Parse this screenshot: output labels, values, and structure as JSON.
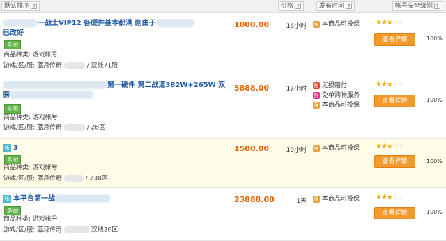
{
  "header": {
    "sort_default": "默认排序",
    "price": "价格",
    "publish_time": "发布时间",
    "security_level": "帐号安全级别"
  },
  "labels": {
    "category": "商品种类:",
    "server": "游戏/区/服:",
    "view_button": "查看详情",
    "tag_text": "多图",
    "icon_tag": "帐"
  },
  "listings": [
    {
      "title_line1": "一战士VIP12 各硬件基本都满 刚由于",
      "title_line2": "已改好",
      "category_value": "游戏帐号",
      "game": "蓝月传奇",
      "server": "/ 双线71服",
      "price": "1000.00",
      "time": "16小时",
      "guarantees": [
        "本商品可投保"
      ],
      "stars": 3,
      "percent": "100%"
    },
    {
      "title_line1": "第一硬件 第二战道382W+265W 双16翅",
      "title_line2": "膀",
      "category_value": "游戏帐号",
      "game": "蓝月传奇",
      "server": "/ 28区",
      "price": "5888.00",
      "time": "17小时",
      "guarantees": [
        "无损赔付",
        "免单购物服务",
        "本商品可投保"
      ],
      "stars": 3,
      "percent": "100%"
    },
    {
      "title_line1": "3",
      "category_value": "游戏帐号",
      "game": "蓝月传奇",
      "server": "/ 238区",
      "price": "1500.00",
      "time": "19小时",
      "guarantees": [
        "本商品可投保"
      ],
      "stars": 3,
      "percent": "100%"
    },
    {
      "title_line1": "本平台第一战",
      "category_value": "游戏帐号",
      "game": "蓝月传奇",
      "server": "双线20区",
      "price": "23888.00",
      "time": "1天",
      "guarantees": [
        "本商品可投保"
      ],
      "stars": 3,
      "percent": "100%"
    }
  ]
}
